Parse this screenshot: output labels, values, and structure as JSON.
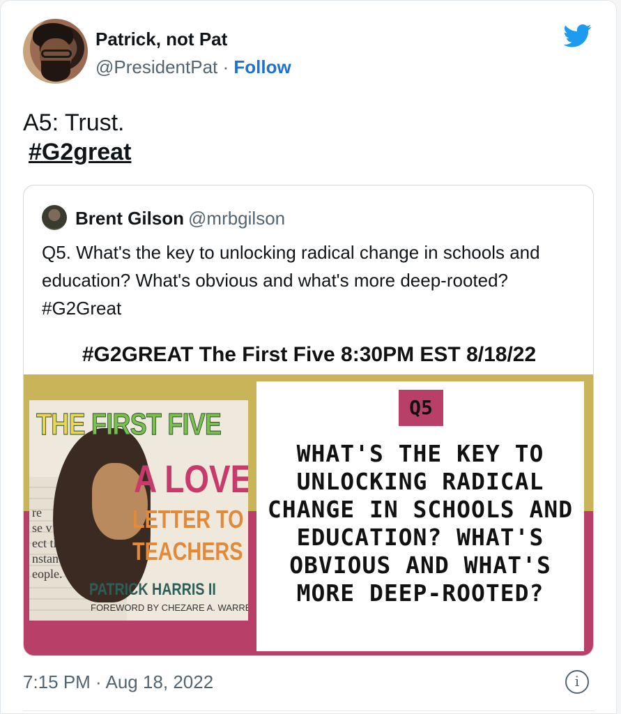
{
  "tweet": {
    "author_name": "Patrick, not Pat",
    "handle": "@PresidentPat",
    "separator": "·",
    "follow_label": "Follow",
    "text_line1": "A5: Trust.",
    "hashtag": "#G2great",
    "timestamp": "7:15 PM · Aug 18, 2022",
    "info_icon": "info-icon",
    "brand_icon": "twitter-bird-icon",
    "accent_color": "#1d9bf0"
  },
  "quoted": {
    "author_name": "Brent Gilson",
    "handle": "@mrbgilson",
    "text": "Q5. What's the key to unlocking radical change in schools and education? What's obvious and what's more deep-rooted? #G2Great",
    "image": {
      "banner": "#G2GREAT The First Five 8:30PM EST 8/18/22",
      "book": {
        "title_part1": "THE",
        "title_part2": "FIRST FIVE",
        "subtitle1": "A LOVE",
        "subtitle2": "LETTER TO",
        "subtitle3": "TEACHERS",
        "author": "PATRICK HARRIS II",
        "foreword": "FOREWORD BY CHEZARE A. WARREN"
      },
      "question_label": "Q5",
      "question_text": "WHAT'S THE KEY TO UNLOCKING RADICAL CHANGE IN SCHOOLS AND EDUCATION? WHAT'S OBVIOUS AND WHAT'S MORE DEEP-ROOTED?"
    }
  }
}
